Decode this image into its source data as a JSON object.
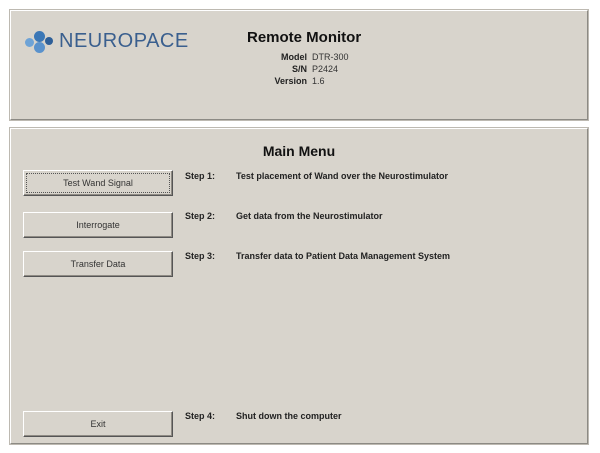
{
  "header": {
    "logo_text": "NEUROPACE",
    "app_title": "Remote Monitor",
    "info": [
      {
        "label": "Model",
        "value": "DTR-300"
      },
      {
        "label": "S/N",
        "value": "P2424"
      },
      {
        "label": "Version",
        "value": "1.6"
      }
    ]
  },
  "main": {
    "title": "Main Menu",
    "buttons": {
      "test_wand": "Test Wand Signal",
      "interrogate": "Interrogate",
      "transfer": "Transfer Data",
      "exit": "Exit"
    },
    "steps": [
      {
        "label": "Step 1:",
        "text": "Test placement of Wand over the Neurostimulator"
      },
      {
        "label": "Step 2:",
        "text": "Get data from the Neurostimulator"
      },
      {
        "label": "Step 3:",
        "text": "Transfer data to Patient Data Management System"
      },
      {
        "label": "Step 4:",
        "text": "Shut down the computer"
      }
    ]
  },
  "colors": {
    "panel_bg": "#d8d4cc",
    "logo_blue": "#3b77b6"
  }
}
